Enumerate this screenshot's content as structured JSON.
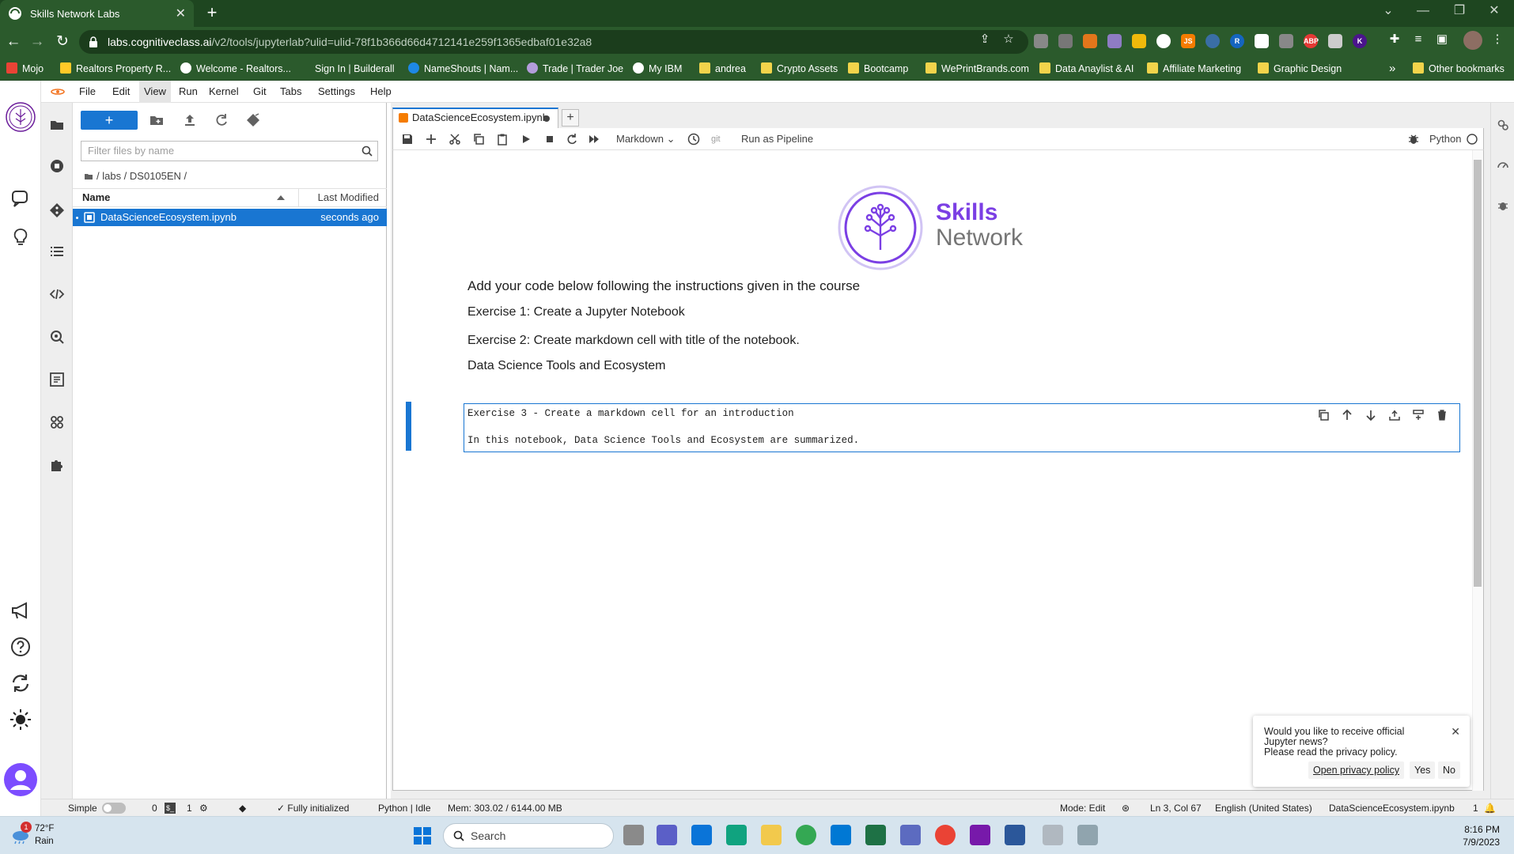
{
  "browser": {
    "tab_title": "Skills Network Labs",
    "url_host": "labs.cognitiveclass.ai",
    "url_path": "/v2/tools/jupyterlab?ulid=ulid-78f1b366d66d4712141e259f1365edbaf01e32a8"
  },
  "bookmarks": [
    {
      "label": "Mojo",
      "icon": "gmail-icon"
    },
    {
      "label": "Realtors Property R...",
      "icon": "house-icon"
    },
    {
      "label": "Welcome - Realtors...",
      "icon": "site-icon"
    },
    {
      "label": "Sign In | Builderall",
      "icon": "site-icon"
    },
    {
      "label": "NameShouts | Nam...",
      "icon": "site-icon"
    },
    {
      "label": "Trade | Trader Joe",
      "icon": "site-icon"
    },
    {
      "label": "My IBM",
      "icon": "globe-icon"
    },
    {
      "label": "andrea",
      "icon": "folder-icon"
    },
    {
      "label": "Crypto Assets",
      "icon": "folder-icon"
    },
    {
      "label": "Bootcamp",
      "icon": "folder-icon"
    },
    {
      "label": "WePrintBrands.com",
      "icon": "folder-icon"
    },
    {
      "label": "Data Anaylist & AI",
      "icon": "folder-icon"
    },
    {
      "label": "Affiliate Marketing",
      "icon": "folder-icon"
    },
    {
      "label": "Graphic Design",
      "icon": "folder-icon"
    }
  ],
  "bookmarks_overflow": "»",
  "other_bookmarks": "Other bookmarks",
  "menu": [
    "File",
    "Edit",
    "View",
    "Run",
    "Kernel",
    "Git",
    "Tabs",
    "Settings",
    "Help"
  ],
  "filebrowser": {
    "filter_placeholder": "Filter files by name",
    "breadcrumb": "/ labs / DS0105EN /",
    "col_name": "Name",
    "col_modified": "Last Modified",
    "files": [
      {
        "name": "DataScienceEcosystem.ipynb",
        "modified": "seconds ago"
      }
    ]
  },
  "notebook": {
    "tab_name": "DataScienceEcosystem.ipynb",
    "cell_type": "Markdown",
    "git_label": "git",
    "pipeline_label": "Run as Pipeline",
    "kernel": "Python",
    "brand_line1": "Skills",
    "brand_line2": "Network",
    "heading": "Add your code below following the instructions given in the course",
    "para1": "Exercise 1: Create a Jupyter Notebook",
    "para2": "Exercise 2: Create markdown cell with title of the notebook.",
    "para3": "Data Science Tools and Ecosystem",
    "editor_lines": [
      "Exercise 3 - Create a markdown cell for an introduction",
      "",
      "In this notebook, Data Science Tools and Ecosystem are summarized."
    ]
  },
  "status": {
    "simple": "Simple",
    "count1": "0",
    "count2": "1",
    "init": "Fully initialized",
    "kernel_state": "Python | Idle",
    "memory": "Mem: 303.02 / 6144.00 MB",
    "mode": "Mode: Edit",
    "cursor": "Ln 3, Col 67",
    "language": "English (United States)",
    "file": "DataScienceEcosystem.ipynb",
    "notifications": "1"
  },
  "toast": {
    "message": "Would you like to receive official Jupyter news?\nPlease read the privacy policy.",
    "link": "Open privacy policy",
    "yes": "Yes",
    "no": "No"
  },
  "taskbar": {
    "temp": "72°F",
    "condition": "Rain",
    "weather_badge": "1",
    "search": "Search",
    "time": "8:16 PM",
    "date": "7/9/2023"
  },
  "colors": {
    "browser_frame": "#2b5a2c",
    "jupyter_blue": "#1976d2",
    "brand_purple": "#7b3fe4"
  }
}
